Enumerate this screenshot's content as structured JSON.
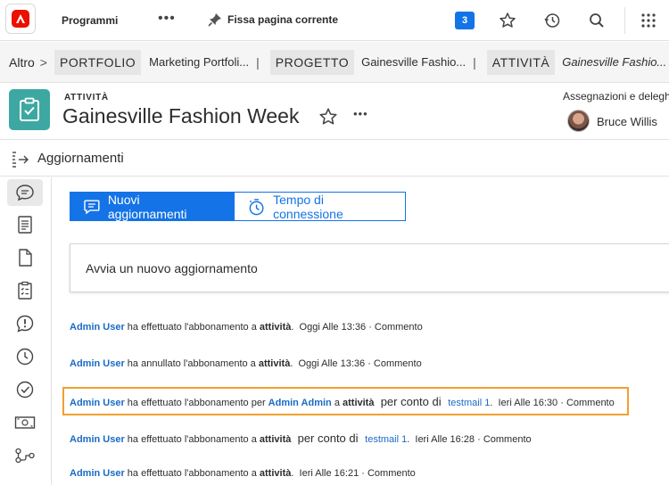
{
  "topbar": {
    "programs_label": "Programmi",
    "more_label": "•••",
    "pin_label": "Fissa pagina corrente",
    "notification_count": "3"
  },
  "breadcrumb": {
    "more_label": "Altro",
    "more_sep": ">",
    "items": [
      {
        "type": "PORTFOLIO",
        "name": "Marketing Portfoli..."
      },
      {
        "type": "PROGETTO",
        "name": "Gainesville Fashio..."
      },
      {
        "type": "ATTIVITÀ",
        "name": "Gainesville Fashio..."
      }
    ],
    "divider": "|"
  },
  "header": {
    "object_type": "ATTIVITÀ",
    "title": "Gainesville Fashion Week",
    "more_label": "•••",
    "assignments_label": "Assegnazioni e deleghe",
    "assignee": "Bruce Willis"
  },
  "updates": {
    "section_title": "Aggiornamenti",
    "tabs": [
      {
        "label": "Nuovi aggiornamenti",
        "active": true
      },
      {
        "label": "Tempo di connessione",
        "active": false
      }
    ],
    "new_update_placeholder": "Avvia un nuovo aggiornamento",
    "feed": [
      {
        "user": "Admin User",
        "text1": " ha effettuato l'abbonamento a ",
        "object": "attività",
        "tail": ".  Oggi Alle 13:36 · ",
        "comment": "Commento"
      },
      {
        "user": "Admin User",
        "text1": " ha annullato l'abbonamento a ",
        "object": "attività",
        "tail": ".  Oggi Alle 13:36 · ",
        "comment": "Commento"
      },
      {
        "user": "Admin User",
        "text1": " ha effettuato l'abbonamento per ",
        "target": "Admin Admin",
        "text2": " a ",
        "object": "attività",
        "behalf": "  per conto di ",
        "via": "testmail 1",
        "tail": ".  Ieri Alle 16:30 · ",
        "comment": "Commento"
      },
      {
        "user": "Admin User",
        "text1": " ha effettuato l'abbonamento a ",
        "object": "attività",
        "behalf": "  per conto di ",
        "via": "testmail 1",
        "tail": ".  Ieri Alle 16:28 · ",
        "comment": "Commento"
      },
      {
        "user": "Admin User",
        "text1": " ha effettuato l'abbonamento a ",
        "object": "attività",
        "tail": ".  Ieri Alle 16:21 · ",
        "comment": "Commento"
      }
    ]
  },
  "colors": {
    "accent": "#1473e6",
    "task_icon_bg": "#3da8a2",
    "highlight": "#f0a030",
    "link": "#1a6bc5"
  },
  "icons": [
    "adobe-logo-icon",
    "pin-icon",
    "star-icon",
    "history-icon",
    "search-icon",
    "apps-grid-icon",
    "task-clipboard-icon",
    "updates-list-icon",
    "chat-bubble-icon",
    "document-icon",
    "file-icon",
    "checklist-icon",
    "issue-icon",
    "clock-icon",
    "check-circle-icon",
    "money-icon",
    "workflow-icon",
    "timer-icon"
  ]
}
